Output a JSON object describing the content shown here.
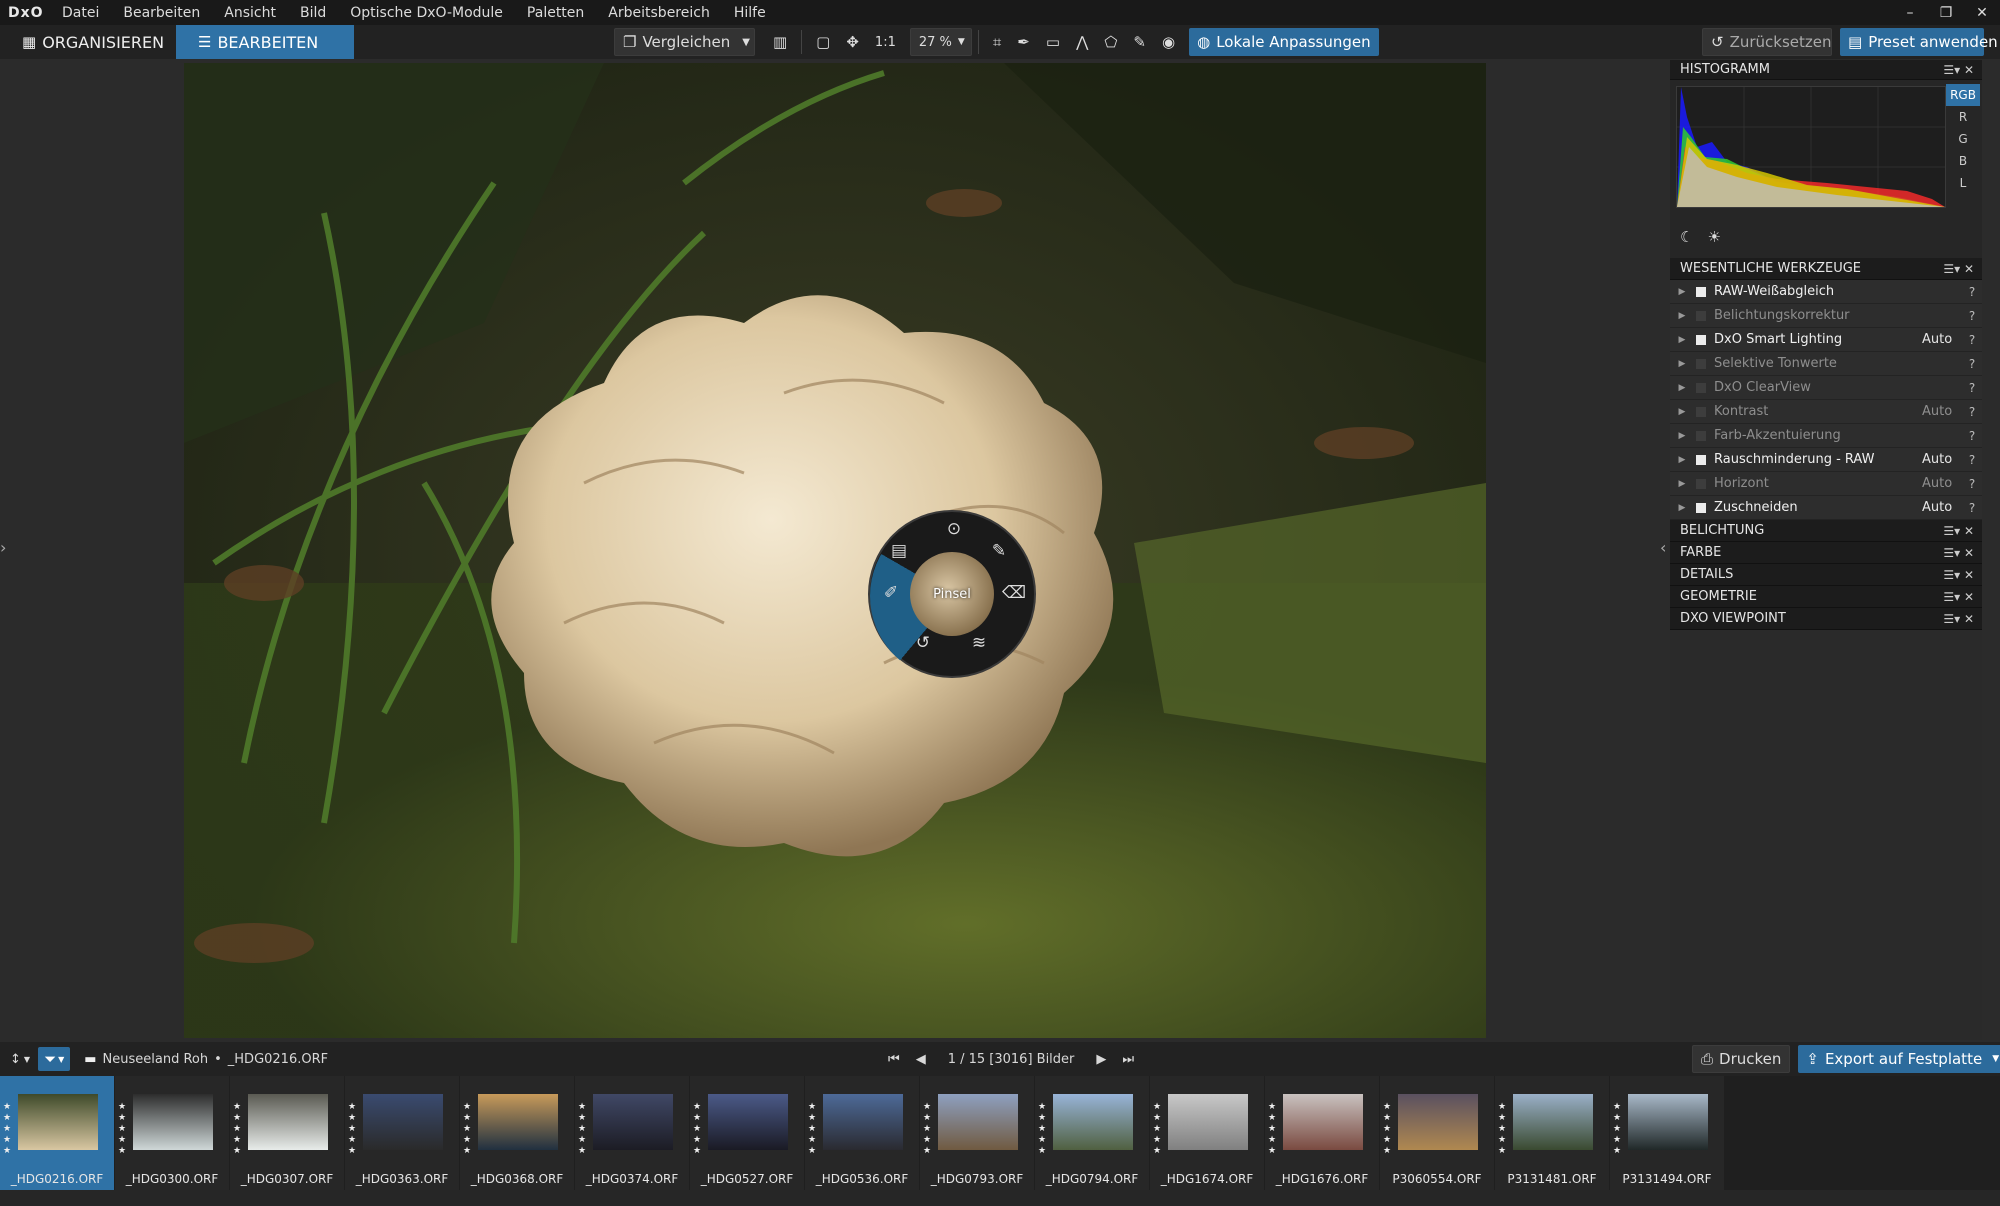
{
  "app": {
    "logo": "DxO"
  },
  "menu": [
    "Datei",
    "Bearbeiten",
    "Ansicht",
    "Bild",
    "Optische DxO-Module",
    "Paletten",
    "Arbeitsbereich",
    "Hilfe"
  ],
  "window_controls": {
    "minimize": "–",
    "restore": "❐",
    "close": "✕"
  },
  "tabs": {
    "organize": "ORGANISIEREN",
    "edit": "BEARBEITEN"
  },
  "toolbar": {
    "compare": "Vergleichen",
    "one_to_one": "1:1",
    "zoom": "27 %",
    "local_adjust": "Lokale Anpassungen",
    "reset": "Zurücksetzen",
    "apply_preset": "Preset anwenden"
  },
  "radial_menu": {
    "center_label": "Pinsel"
  },
  "histogram": {
    "title": "HISTOGRAMM",
    "channels": [
      "RGB",
      "R",
      "G",
      "B",
      "L"
    ],
    "selected_channel": "RGB"
  },
  "essential_tools": {
    "title": "WESENTLICHE WERKZEUGE",
    "items": [
      {
        "name": "RAW-Weißabgleich",
        "auto": "",
        "enabled": true
      },
      {
        "name": "Belichtungskorrektur",
        "auto": "",
        "enabled": false
      },
      {
        "name": "DxO Smart Lighting",
        "auto": "Auto",
        "enabled": true
      },
      {
        "name": "Selektive Tonwerte",
        "auto": "",
        "enabled": false
      },
      {
        "name": "DxO ClearView",
        "auto": "",
        "enabled": false
      },
      {
        "name": "Kontrast",
        "auto": "Auto",
        "enabled": false
      },
      {
        "name": "Farb-Akzentuierung",
        "auto": "",
        "enabled": false
      },
      {
        "name": "Rauschminderung - RAW",
        "auto": "Auto",
        "enabled": true
      },
      {
        "name": "Horizont",
        "auto": "Auto",
        "enabled": false
      },
      {
        "name": "Zuschneiden",
        "auto": "Auto",
        "enabled": true
      }
    ]
  },
  "categories": [
    "BELICHTUNG",
    "FARBE",
    "DETAILS",
    "GEOMETRIE",
    "DXO VIEWPOINT"
  ],
  "palette_ctl": "☰▾ ✕",
  "help": "?",
  "filmstrip_bar": {
    "sort": "↕",
    "folder": "Neuseeland Roh",
    "separator": "•",
    "file": "_HDG0216.ORF",
    "counter": "1 / 15 [3016] Bilder",
    "print": "Drucken",
    "export": "Export auf Festplatte"
  },
  "thumbnails": [
    {
      "name": "_HDG0216.ORF",
      "selected": true
    },
    {
      "name": "_HDG0300.ORF",
      "selected": false
    },
    {
      "name": "_HDG0307.ORF",
      "selected": false
    },
    {
      "name": "_HDG0363.ORF",
      "selected": false
    },
    {
      "name": "_HDG0368.ORF",
      "selected": false
    },
    {
      "name": "_HDG0374.ORF",
      "selected": false
    },
    {
      "name": "_HDG0527.ORF",
      "selected": false
    },
    {
      "name": "_HDG0536.ORF",
      "selected": false
    },
    {
      "name": "_HDG0793.ORF",
      "selected": false
    },
    {
      "name": "_HDG0794.ORF",
      "selected": false
    },
    {
      "name": "_HDG1674.ORF",
      "selected": false
    },
    {
      "name": "_HDG1676.ORF",
      "selected": false
    },
    {
      "name": "P3060554.ORF",
      "selected": false
    },
    {
      "name": "P3131481.ORF",
      "selected": false
    },
    {
      "name": "P3131494.ORF",
      "selected": false
    }
  ],
  "colors": {
    "accent": "#2f72a6",
    "panel": "#2a2a2a",
    "menubar": "#191919"
  }
}
